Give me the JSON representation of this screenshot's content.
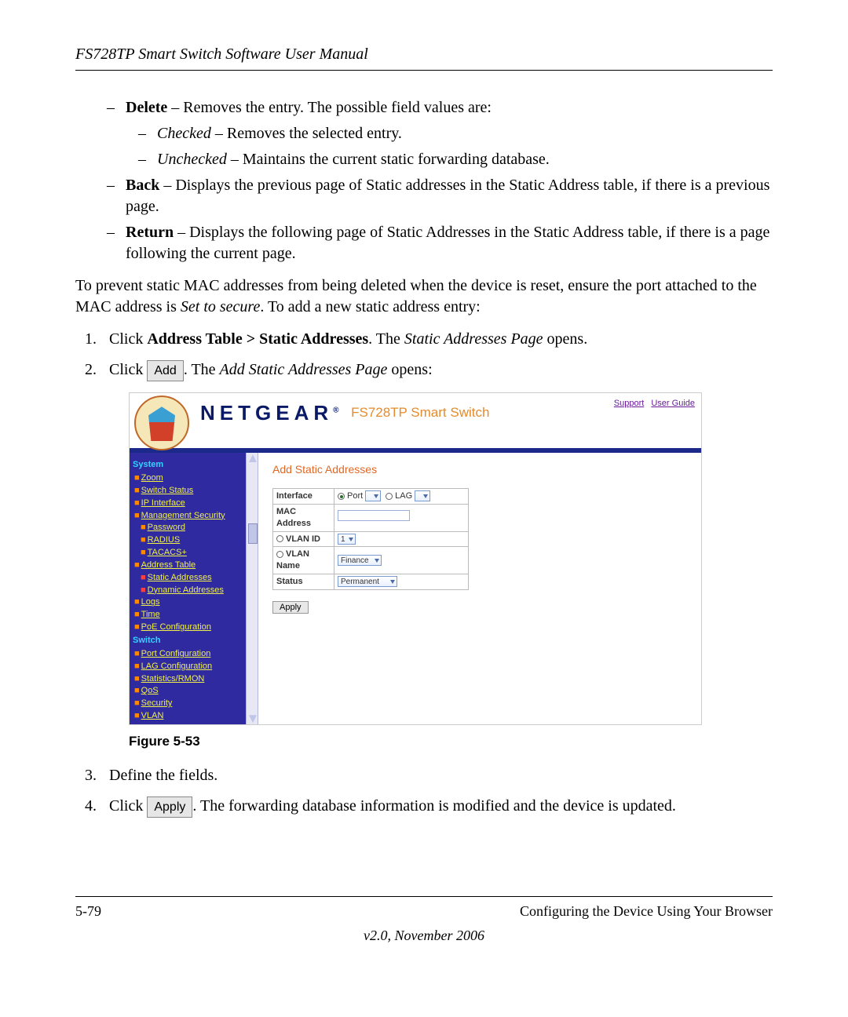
{
  "header_title": "FS728TP Smart Switch Software User Manual",
  "bullets": {
    "delete_term": "Delete",
    "delete_desc": " – Removes the entry. The possible field values are:",
    "checked_term": "Checked",
    "checked_desc": " – Removes the selected entry.",
    "unchecked_term": "Unchecked",
    "unchecked_desc": " – Maintains the current static forwarding database.",
    "back_term": "Back",
    "back_desc": " – Displays the previous page of Static addresses in the Static Address table, if there is a previous page.",
    "return_term": "Return",
    "return_desc": " – Displays the following page of Static Addresses in the Static Address table, if there is a page following the current page."
  },
  "para1_a": "To prevent static MAC addresses from being deleted when the device is reset, ensure the port attached to the MAC address is ",
  "para1_em": "Set to secure",
  "para1_b": ". To add a new static address entry:",
  "steps": {
    "s1_a": "Click ",
    "s1_bold": "Address Table > Static Addresses",
    "s1_b": ". The ",
    "s1_em": "Static Addresses Page",
    "s1_c": " opens.",
    "s2_a": "Click ",
    "s2_btn": "Add",
    "s2_b": ". The ",
    "s2_em": "Add Static Addresses Page",
    "s2_c": " opens:",
    "s3": "Define the fields.",
    "s4_a": "Click ",
    "s4_btn": "Apply",
    "s4_b": ". The forwarding database information is modified and the device is updated."
  },
  "fig_caption": "Figure 5-53",
  "app": {
    "brand": "NETGEAR",
    "device": "FS728TP Smart Switch",
    "hdr_links": {
      "support": "Support",
      "user_guide": "User Guide"
    },
    "page_title": "Add Static Addresses",
    "form": {
      "row1_label": "Interface",
      "row1_port": "Port",
      "row1_lag": "LAG",
      "row2_label": "MAC Address",
      "row3_label": "VLAN ID",
      "row3_val": "1",
      "row4_label": "VLAN Name",
      "row4_val": "Finance",
      "row5_label": "Status",
      "row5_val": "Permanent",
      "apply": "Apply"
    },
    "nav": {
      "system": "System",
      "zoom": "Zoom",
      "switch_status": "Switch Status",
      "ip_interface": "IP Interface",
      "mgmt_sec": "Management Security",
      "password": "Password",
      "radius": "RADIUS",
      "tacacs": "TACACS+",
      "address_table": "Address Table",
      "static_addr": "Static Addresses",
      "dynamic_addr": "Dynamic Addresses",
      "logs": "Logs",
      "time": "Time",
      "poe": "PoE Configuration",
      "switch": "Switch",
      "port_cfg": "Port Configuration",
      "lag_cfg": "LAG Configuration",
      "stats": "Statistics/RMON",
      "qos": "QoS",
      "security": "Security",
      "vlan": "VLAN"
    }
  },
  "footer": {
    "left": "5-79",
    "right": "Configuring the Device Using Your Browser",
    "version": "v2.0, November 2006"
  }
}
